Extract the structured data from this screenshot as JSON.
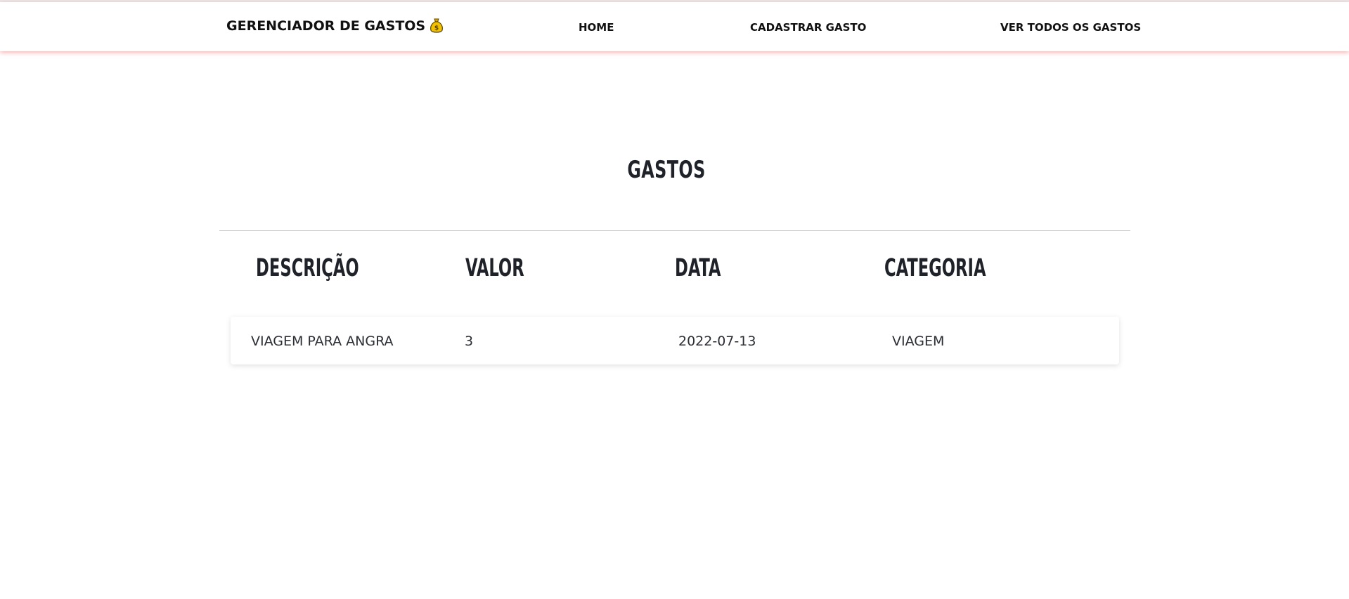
{
  "navbar": {
    "brand": "GERENCIADOR DE GASTOS",
    "brand_icon": "money-bag-icon",
    "links": [
      {
        "label": "HOME"
      },
      {
        "label": "CADASTRAR GASTO"
      },
      {
        "label": "VER TODOS OS GASTOS"
      }
    ],
    "shadow_color": "#ff6e6e"
  },
  "main": {
    "title": "GASTOS",
    "table": {
      "columns": [
        "DESCRIÇÃO",
        "VALOR",
        "DATA",
        "CATEGORIA"
      ],
      "rows": [
        {
          "descricao": "VIAGEM PARA ANGRA",
          "valor": "3",
          "data": "2022-07-13",
          "categoria": "VIAGEM"
        }
      ]
    }
  }
}
